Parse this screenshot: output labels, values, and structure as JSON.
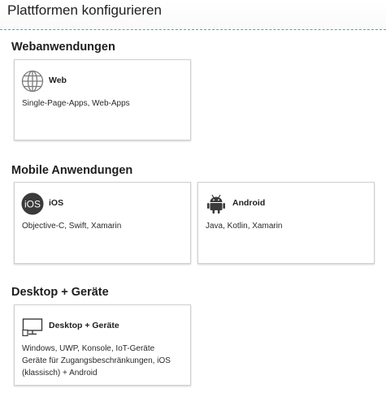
{
  "header": {
    "title": "Plattformen konfigurieren"
  },
  "sections": {
    "web": {
      "heading": "Webanwendungen",
      "cards": [
        {
          "title": "Web",
          "description": "Single-Page-Apps, Web-Apps",
          "icon": "globe-icon"
        }
      ]
    },
    "mobile": {
      "heading": "Mobile Anwendungen",
      "cards": [
        {
          "title": "iOS",
          "description": "Objective-C, Swift, Xamarin",
          "icon": "ios-icon"
        },
        {
          "title": "Android",
          "description": "Java, Kotlin, Xamarin",
          "icon": "android-icon"
        }
      ]
    },
    "desktop": {
      "heading": "Desktop + Geräte",
      "cards": [
        {
          "title": "Desktop + Geräte",
          "description_lines": [
            "Windows, UWP, Konsole, IoT-Geräte",
            "Geräte für Zugangsbeschränkungen, iOS",
            "(klassisch) + Android"
          ],
          "icon": "desktop-monitor-icon"
        }
      ]
    }
  }
}
